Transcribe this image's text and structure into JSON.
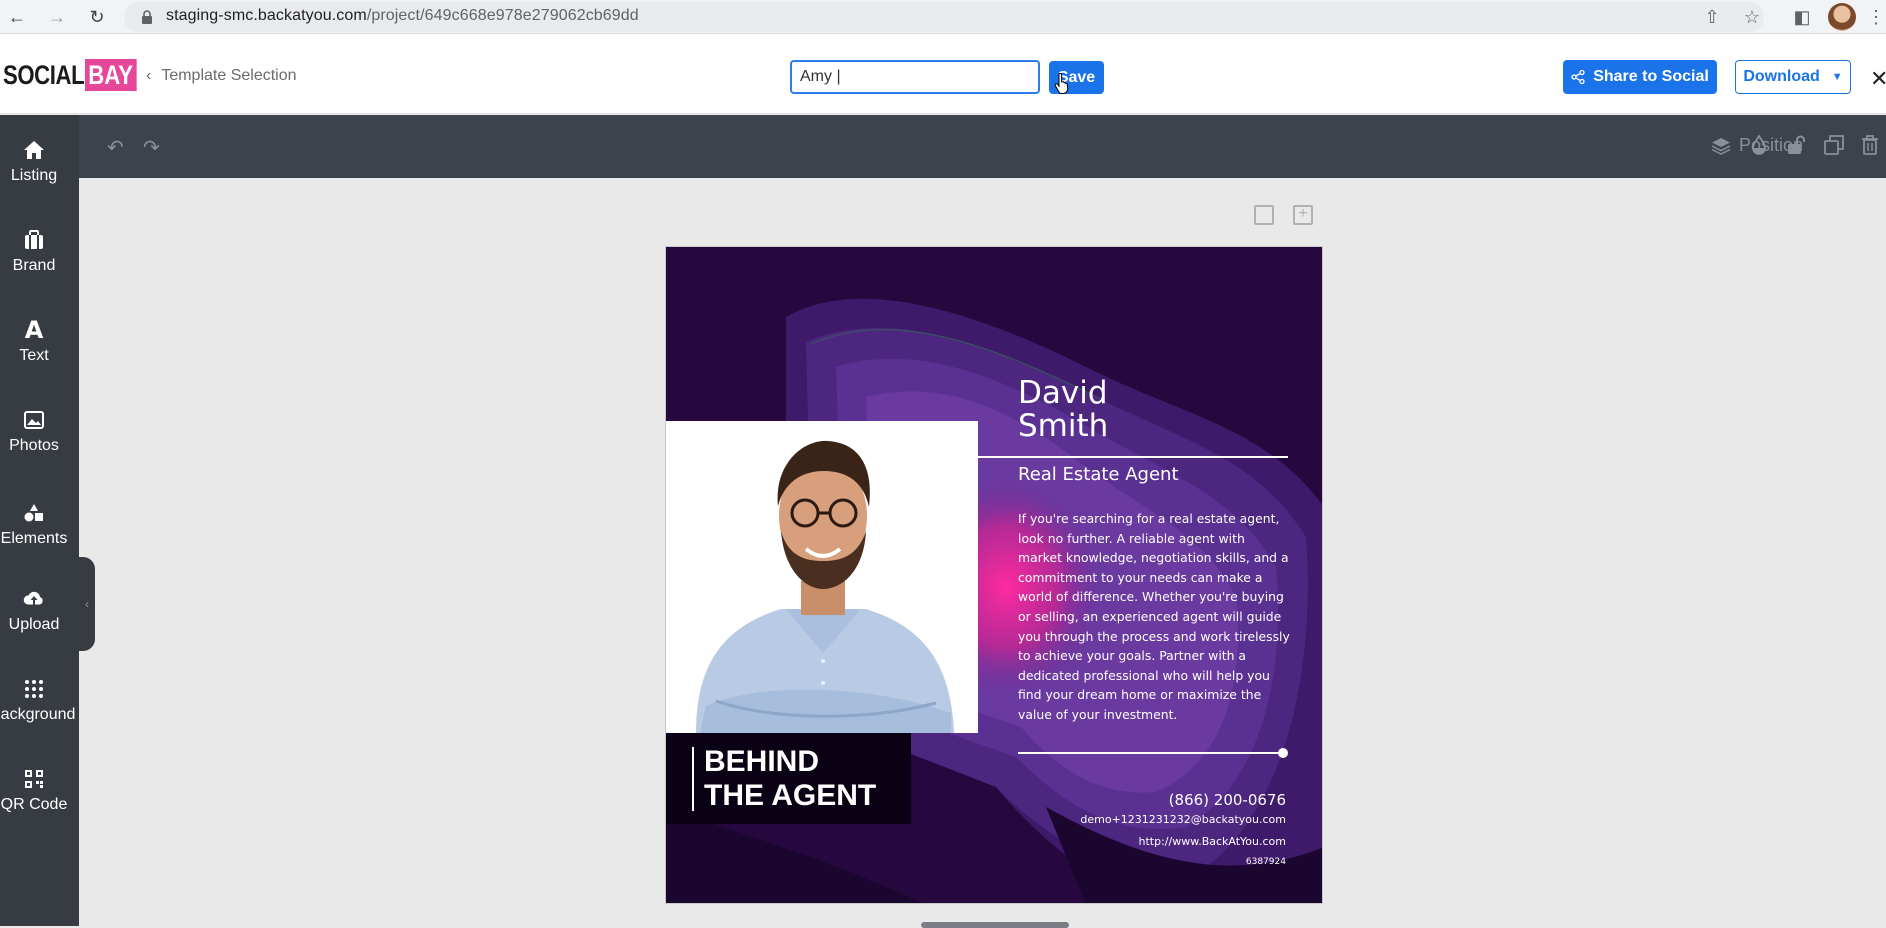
{
  "browser": {
    "url_host": "staging-smc.backatyou.com",
    "url_path": "/project/649c668e978e279062cb69dd"
  },
  "header": {
    "logo_part1": "SOCIAL",
    "logo_part2": "BAY",
    "back_label": "Template Selection",
    "project_name_value": "Amy |",
    "save_label": "Save",
    "share_label": "Share to Social",
    "download_label": "Download"
  },
  "sidebar": {
    "items": [
      {
        "label": "Listing",
        "icon": "home-icon"
      },
      {
        "label": "Brand",
        "icon": "briefcase-icon"
      },
      {
        "label": "Text",
        "icon": "text-icon"
      },
      {
        "label": "Photos",
        "icon": "image-icon"
      },
      {
        "label": "Elements",
        "icon": "shapes-icon"
      },
      {
        "label": "Upload",
        "icon": "upload-icon"
      },
      {
        "label": "Background",
        "icon": "dots-grid-icon"
      },
      {
        "label": "QR Code",
        "icon": "qr-code-icon"
      }
    ]
  },
  "toolbar": {
    "position_label": "Position"
  },
  "design": {
    "first_name": "David",
    "last_name": "Smith",
    "title": "Real Estate Agent",
    "bio": "If you're searching for a real estate agent, look no further. A reliable agent with market knowledge, negotiation skills, and a commitment to your needs can make a world of difference. Whether you're buying or selling, an experienced agent will guide you through the process and work tirelessly to achieve your goals. Partner with a dedicated professional who will help you find your dream home or maximize the value of your investment.",
    "phone": "(866) 200-0676",
    "email": "demo+1231231232@backatyou.com",
    "website": "http://www.BackAtYou.com",
    "license": "6387924",
    "banner_line1": "BEHIND",
    "banner_line2": "THE AGENT"
  },
  "colors": {
    "accent": "#1a73e8",
    "brand_pink": "#e6479a",
    "sidebar": "#373c43",
    "toolbar": "#3d434b",
    "design_bg": "#26083f"
  }
}
